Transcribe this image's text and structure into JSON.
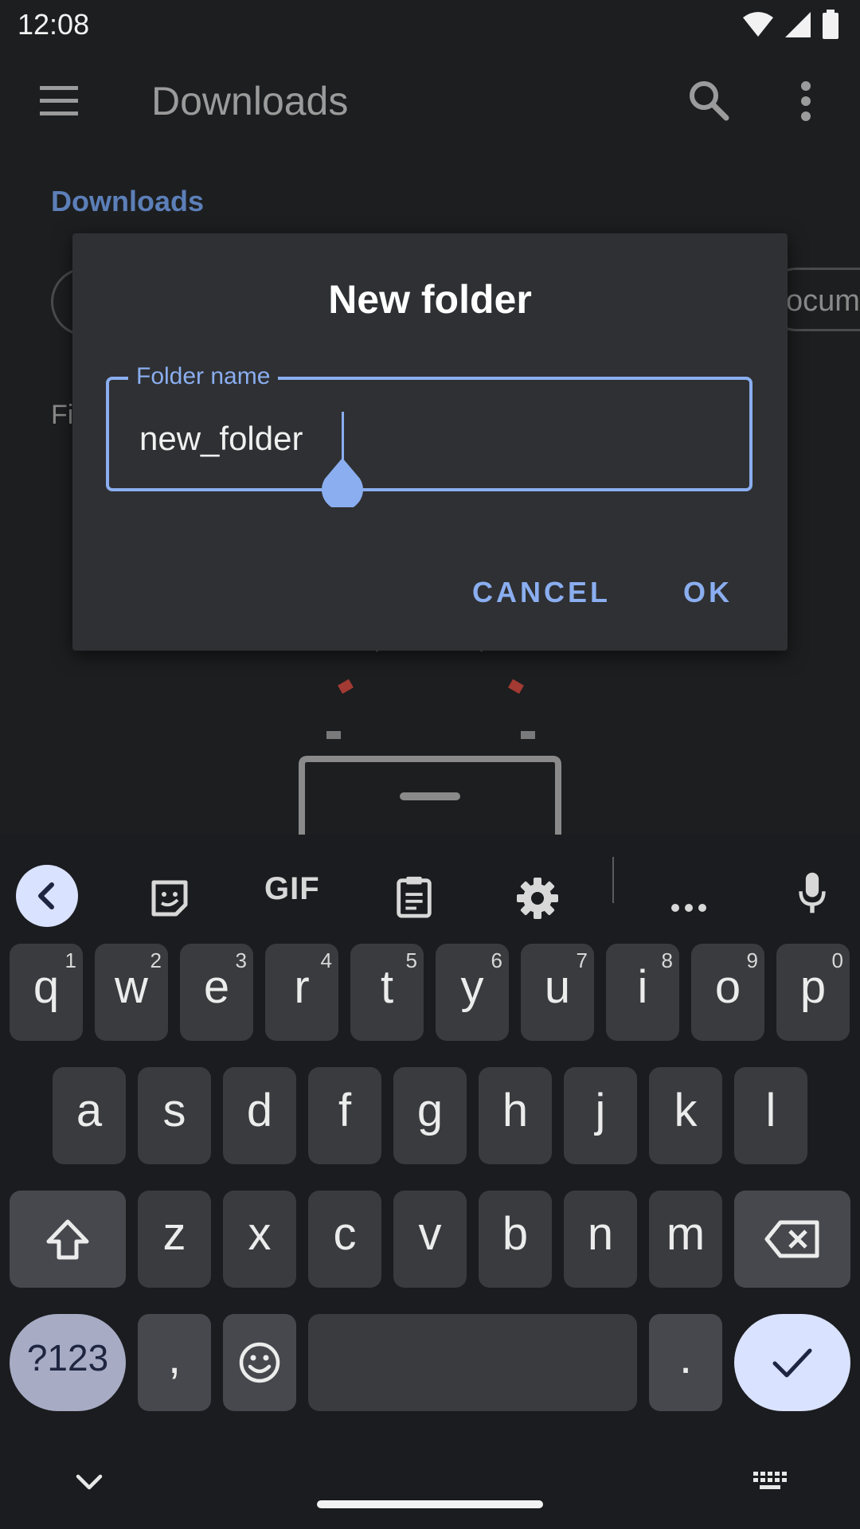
{
  "status_bar": {
    "time": "12:08",
    "icons": [
      "wifi-icon",
      "signal-icon",
      "battery-icon"
    ]
  },
  "toolbar": {
    "title": "Downloads",
    "icons": [
      "menu-icon",
      "search-icon",
      "more-vert-icon"
    ]
  },
  "breadcrumb": {
    "label": "Downloads"
  },
  "chips": {
    "right_partial": "ocum"
  },
  "section_label_partial": "Fi",
  "dialog": {
    "title": "New folder",
    "field_label": "Folder name",
    "field_value": "new_folder",
    "cancel_label": "CANCEL",
    "ok_label": "OK"
  },
  "keyboard": {
    "toolbar_icons": [
      "back-chevron-icon",
      "sticker-icon",
      "gif-icon",
      "clipboard-icon",
      "settings-icon",
      "more-horiz-icon",
      "mic-icon"
    ],
    "gif_label": "GIF",
    "row1": [
      {
        "key": "q",
        "hint": "1"
      },
      {
        "key": "w",
        "hint": "2"
      },
      {
        "key": "e",
        "hint": "3"
      },
      {
        "key": "r",
        "hint": "4"
      },
      {
        "key": "t",
        "hint": "5"
      },
      {
        "key": "y",
        "hint": "6"
      },
      {
        "key": "u",
        "hint": "7"
      },
      {
        "key": "i",
        "hint": "8"
      },
      {
        "key": "o",
        "hint": "9"
      },
      {
        "key": "p",
        "hint": "0"
      }
    ],
    "row2": [
      "a",
      "s",
      "d",
      "f",
      "g",
      "h",
      "j",
      "k",
      "l"
    ],
    "row3": [
      "z",
      "x",
      "c",
      "v",
      "b",
      "n",
      "m"
    ],
    "symbols_label": "?123",
    "comma_label": ",",
    "period_label": ".",
    "special_icons": [
      "shift-icon",
      "backspace-icon",
      "emoji-icon",
      "enter-check-icon"
    ]
  },
  "nav_bar": {
    "icons": [
      "keyboard-hide-chevron-icon",
      "keyboard-switch-icon"
    ]
  },
  "colors": {
    "accent": "#8aaef0",
    "dialog_bg": "#2f3033",
    "key_bg": "#3a3b3f",
    "enter_bg": "#d9e2ff",
    "symbols_bg": "#a7abc4"
  }
}
